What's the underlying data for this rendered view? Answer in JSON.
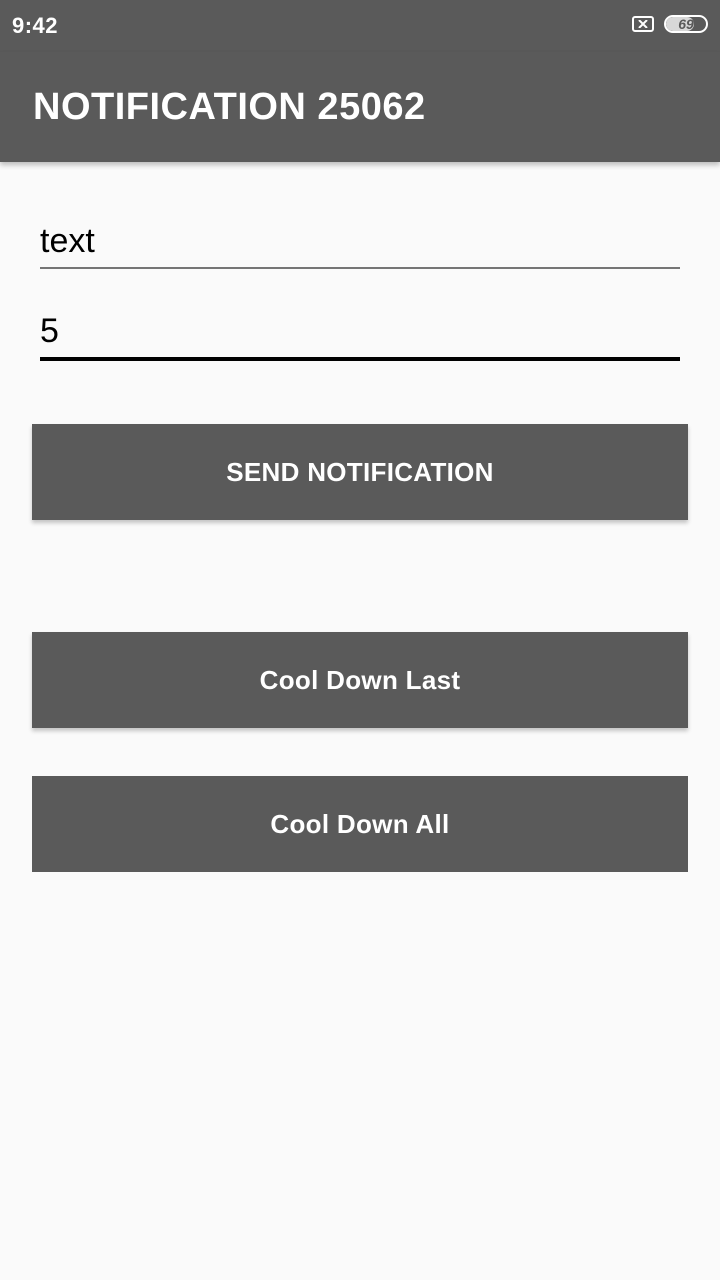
{
  "status_bar": {
    "time": "9:42",
    "battery_level": "69",
    "battery_fraction": 0.69,
    "icons": [
      "sim-missing-icon",
      "battery-icon"
    ]
  },
  "app_bar": {
    "title": "NOTIFICATION 25062"
  },
  "form": {
    "text_field_value": "text",
    "number_field_value": "5"
  },
  "buttons": {
    "send_label": "SEND NOTIFICATION",
    "cool_down_last_label": "Cool Down Last",
    "cool_down_all_label": "Cool Down All"
  },
  "colors": {
    "primary": "#5a5a5a",
    "background": "#fafafa",
    "on_primary": "#ffffff"
  }
}
